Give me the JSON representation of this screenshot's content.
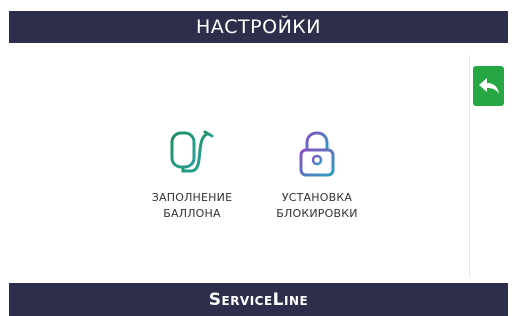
{
  "header": {
    "title": "НАСТРОЙКИ"
  },
  "footer": {
    "brand": "ServiceLine"
  },
  "back_button": {
    "icon": "back-arrow-icon",
    "color": "#27a744"
  },
  "tiles": [
    {
      "icon": "cylinder-fill-icon",
      "line1": "ЗАПОЛНЕНИЕ",
      "line2": "БАЛЛОНА",
      "color": "#1f9a73"
    },
    {
      "icon": "padlock-icon",
      "line1": "УСТАНОВКА",
      "line2": "БЛОКИРОВКИ",
      "color": "#7a5fb5"
    }
  ],
  "colors": {
    "bar": "#2d2e4c",
    "accent_green": "#27a744"
  }
}
